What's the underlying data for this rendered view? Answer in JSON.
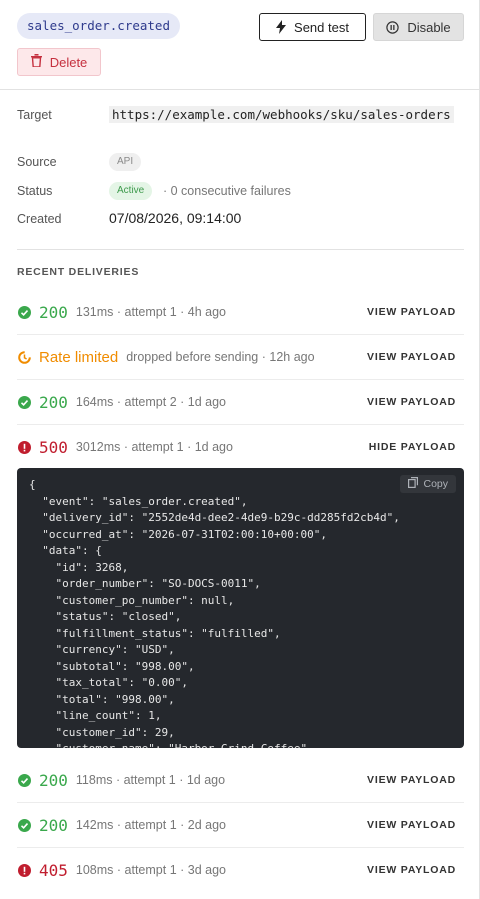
{
  "header": {
    "event_name": "sales_order.created",
    "send_test_label": "Send test",
    "disable_label": "Disable",
    "delete_label": "Delete"
  },
  "details": {
    "target_label": "Target",
    "target_url": "https://example.com/webhooks/sku/sales-orders",
    "source_label": "Source",
    "source_value": "API",
    "status_label": "Status",
    "status_value": "Active",
    "failures_text": "· 0 consecutive failures",
    "created_label": "Created",
    "created_value": "07/08/2026, 09:14:00"
  },
  "deliveries": {
    "title": "RECENT DELIVERIES",
    "rows": [
      {
        "status": "200",
        "kind": "ok",
        "detail": "131ms · attempt 1 · 4h ago",
        "action": "VIEW PAYLOAD"
      },
      {
        "status": "Rate limited",
        "kind": "rate",
        "detail": "dropped before sending · 12h ago",
        "action": "VIEW PAYLOAD"
      },
      {
        "status": "200",
        "kind": "ok",
        "detail": "164ms · attempt 2 · 1d ago",
        "action": "VIEW PAYLOAD"
      },
      {
        "status": "500",
        "kind": "err",
        "detail": "3012ms · attempt 1 · 1d ago",
        "action": "HIDE PAYLOAD"
      },
      {
        "status": "200",
        "kind": "ok",
        "detail": "118ms · attempt 1 · 1d ago",
        "action": "VIEW PAYLOAD"
      },
      {
        "status": "200",
        "kind": "ok",
        "detail": "142ms · attempt 1 · 2d ago",
        "action": "VIEW PAYLOAD"
      },
      {
        "status": "405",
        "kind": "err",
        "detail": "108ms · attempt 1 · 3d ago",
        "action": "VIEW PAYLOAD"
      }
    ]
  },
  "payload": {
    "copy_label": "Copy",
    "text": "{\n  \"event\": \"sales_order.created\",\n  \"delivery_id\": \"2552de4d-dee2-4de9-b29c-dd285fd2cb4d\",\n  \"occurred_at\": \"2026-07-31T02:00:10+00:00\",\n  \"data\": {\n    \"id\": 3268,\n    \"order_number\": \"SO-DOCS-0011\",\n    \"customer_po_number\": null,\n    \"status\": \"closed\",\n    \"fulfillment_status\": \"fulfilled\",\n    \"currency\": \"USD\",\n    \"subtotal\": \"998.00\",\n    \"tax_total\": \"0.00\",\n    \"total\": \"998.00\",\n    \"line_count\": 1,\n    \"customer_id\": 29,\n    \"customer_name\": \"Harbor Grind Coffee\""
  },
  "icons": {
    "ok": "check-circle-icon",
    "rate": "rate-limit-icon",
    "err": "error-circle-icon"
  },
  "colors": {
    "ok": "#3aa84c",
    "rate": "#f08c00",
    "err": "#c01d2e",
    "event_chip_bg": "#e6e9f7",
    "event_chip_text": "#2e3a8c"
  }
}
